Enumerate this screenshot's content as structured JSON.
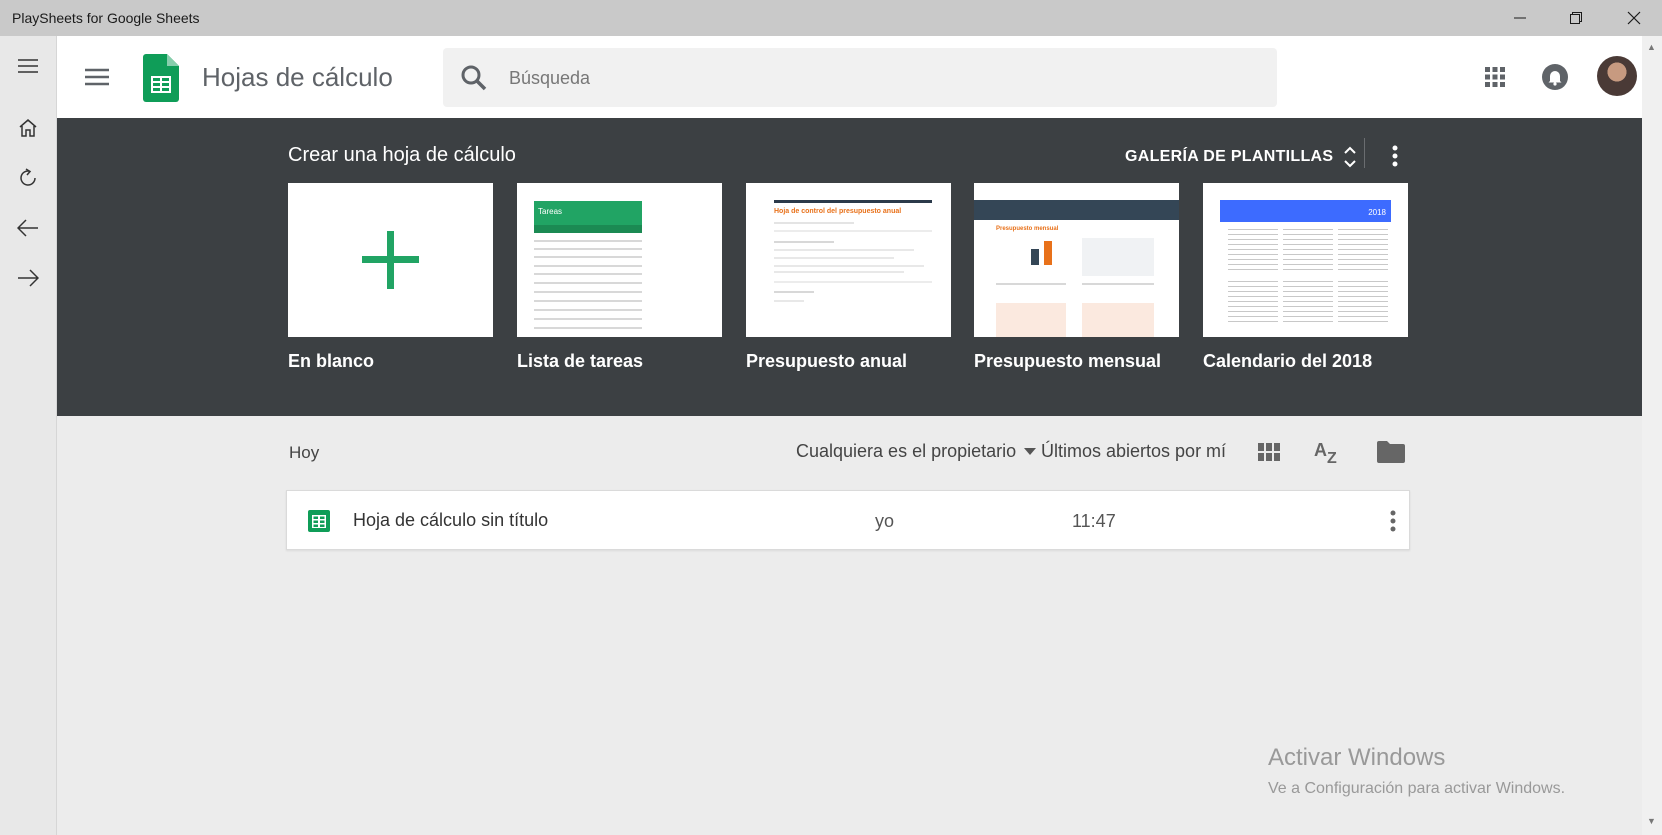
{
  "window": {
    "title": "PlaySheets for Google Sheets"
  },
  "header": {
    "app_title": "Hojas de cálculo",
    "search_placeholder": "Búsqueda"
  },
  "templates": {
    "section_title": "Crear una hoja de cálculo",
    "gallery_label": "GALERÍA DE PLANTILLAS",
    "items": [
      {
        "label": "En blanco"
      },
      {
        "label": "Lista de tareas",
        "thumb_header": "Tareas"
      },
      {
        "label": "Presupuesto anual",
        "thumb_header": "Hoja de control del presupuesto anual"
      },
      {
        "label": "Presupuesto mensual",
        "thumb_header": "Presupuesto mensual"
      },
      {
        "label": "Calendario del 2018",
        "thumb_header": "2018"
      }
    ]
  },
  "recent": {
    "section_label": "Hoy",
    "owner_filter": "Cualquiera es el propietario",
    "sort_label": "Últimos abiertos por mí",
    "files": [
      {
        "name": "Hoja de cálculo sin título",
        "owner": "yo",
        "time": "11:47"
      }
    ]
  },
  "watermark": {
    "line1": "Activar Windows",
    "line2": "Ve a Configuración para activar Windows."
  },
  "colors": {
    "sheets_green": "#0f9d58",
    "band_bg": "#3c4043",
    "accent_orange": "#e8711a",
    "calendar_blue": "#3d6bff"
  }
}
